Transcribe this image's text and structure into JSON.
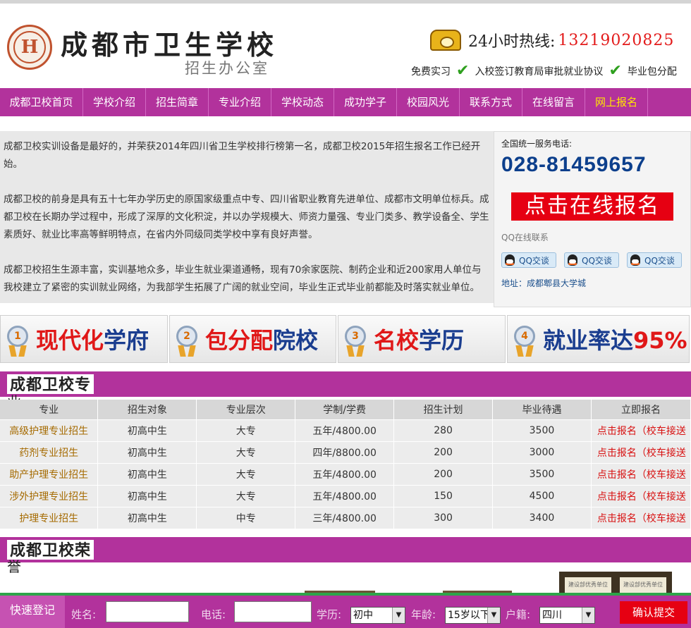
{
  "header": {
    "title": "成都市卫生学校",
    "subtitle": "招生办公室",
    "hotline_label": "24小时热线:",
    "hotline_number": "13219020825",
    "features": [
      "免费实习",
      "入校签订教育局审批就业协议",
      "毕业包分配"
    ]
  },
  "nav": {
    "items": [
      {
        "label": "成都卫校首页",
        "highlight": false
      },
      {
        "label": "学校介绍",
        "highlight": false
      },
      {
        "label": "招生简章",
        "highlight": false
      },
      {
        "label": "专业介绍",
        "highlight": false
      },
      {
        "label": "学校动态",
        "highlight": false
      },
      {
        "label": "成功学子",
        "highlight": false
      },
      {
        "label": "校园风光",
        "highlight": false
      },
      {
        "label": "联系方式",
        "highlight": false
      },
      {
        "label": "在线留言",
        "highlight": false
      },
      {
        "label": "网上报名",
        "highlight": true
      }
    ]
  },
  "intro": {
    "paragraphs": [
      "成都卫校实训设备是最好的，并荣获2014年四川省卫生学校排行榜第一名，成都卫校2015年招生报名工作已经开始。",
      "成都卫校的前身是具有五十七年办学历史的原国家级重点中专、四川省职业教育先进单位、成都市文明单位标兵。成都卫校在长期办学过程中，形成了深厚的文化积淀，并以办学规模大、师资力量强、专业门类多、教学设备全、学生素质好、就业比率高等鲜明特点，在省内外同级同类学校中享有良好声誉。",
      "成都卫校招生生源丰富，实训基地众多，毕业生就业渠道通畅，现有70余家医院、制药企业和近200家用人单位与我校建立了紧密的实训就业网络，为我部学生拓展了广阔的就业空间，毕业生正式毕业前都能及时落实就业单位。"
    ]
  },
  "sidebar": {
    "service_label": "全国统一服务电话:",
    "service_phone": "028-81459657",
    "signup_button": "点击在线报名",
    "qq_label": "QQ在线联系",
    "qq_buttons": [
      "QQ交谈",
      "QQ交谈",
      "QQ交谈"
    ],
    "address": "地址：成都郫县大学城"
  },
  "banners": [
    {
      "num": "1",
      "red": "现代化",
      "blue": "学府",
      "red_first": true
    },
    {
      "num": "2",
      "red": "包分配",
      "blue": "院校",
      "red_first": true
    },
    {
      "num": "3",
      "red": "名校",
      "blue": "学历",
      "red_first": true
    },
    {
      "num": "4",
      "red": "95%",
      "blue": "就业率达",
      "red_first": false
    }
  ],
  "majors_section": {
    "title": "成都卫校专",
    "title_overflow": "业",
    "columns": [
      "专业",
      "招生对象",
      "专业层次",
      "学制/学费",
      "招生计划",
      "毕业待遇",
      "立即报名"
    ],
    "rows": [
      [
        "高级护理专业招生",
        "初高中生",
        "大专",
        "五年/4800.00",
        "280",
        "3500",
        "点击报名（校车接送"
      ],
      [
        "药剂专业招生",
        "初高中生",
        "大专",
        "四年/8800.00",
        "200",
        "3000",
        "点击报名（校车接送"
      ],
      [
        "助产护理专业招生",
        "初高中生",
        "大专",
        "五年/4800.00",
        "200",
        "3500",
        "点击报名（校车接送"
      ],
      [
        "涉外护理专业招生",
        "初高中生",
        "大专",
        "五年/4800.00",
        "150",
        "4500",
        "点击报名（校车接送"
      ],
      [
        "护理专业招生",
        "初高中生",
        "中专",
        "三年/4800.00",
        "300",
        "3400",
        "点击报名（校车接送"
      ]
    ]
  },
  "honor_section": {
    "title": "成都卫校荣",
    "title_overflow": "誉",
    "cert_labels": [
      "建设部优秀单位",
      "建设部优秀单位"
    ]
  },
  "quick_form": {
    "title": "快速登记",
    "name_label": "姓名:",
    "phone_label": "电话:",
    "edu_label": "学历:",
    "edu_value": "初中",
    "age_label": "年龄:",
    "age_value": "15岁以下",
    "origin_label": "户籍:",
    "origin_value": "四川",
    "submit": "确认提交"
  }
}
